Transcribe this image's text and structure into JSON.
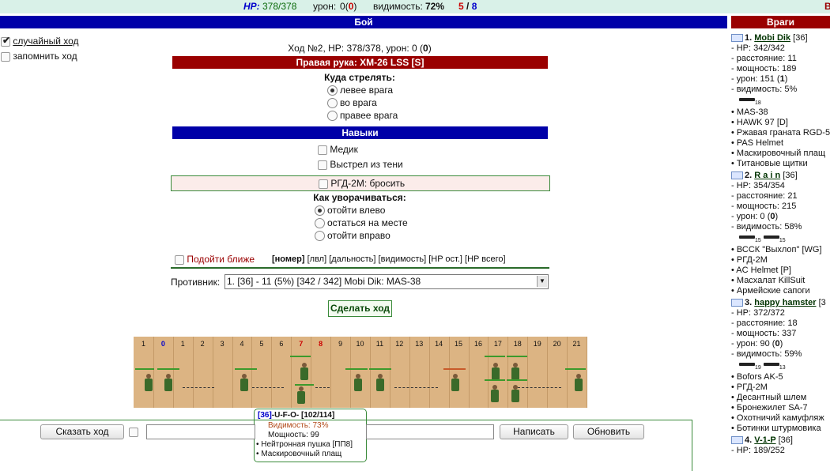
{
  "topbar": {
    "hp_label": "HP:",
    "hp_value": "378/378",
    "damage_label": "урон:",
    "damage_value": "0",
    "damage_paren_open": "(",
    "damage_bonus": "0",
    "damage_paren_close": ")",
    "visibility_label": "видимость:",
    "visibility_value": "72%",
    "team_red": "5",
    "team_sep": "/",
    "team_blue": "8",
    "right_cut": "В"
  },
  "battle_title": "Бой",
  "enemies_title": "Враги",
  "left_options": {
    "random_move": "случайный ход",
    "remember_move": "запомнить ход"
  },
  "turn_info": {
    "prefix": "Ход №2, HP: 378/378, урон: 0 (",
    "bold": "0",
    "suffix": ")"
  },
  "weapon_bar": "Правая рука: XM-26 LSS [S]",
  "shoot": {
    "title": "Куда стрелять:",
    "options": [
      "левее врага",
      "во врага",
      "правее врага"
    ]
  },
  "skills": {
    "title": "Навыки",
    "items": [
      "Медик",
      "Выстрел из тени"
    ]
  },
  "grenade": "РГД-2М: бросить",
  "dodge": {
    "title": "Как уворачиваться:",
    "options": [
      "отойти влево",
      "остаться на месте",
      "отойти вправо"
    ]
  },
  "approach": "Подойти ближе",
  "sort": {
    "number": "[номер]",
    "level": "[лвл]",
    "distance": "[дальность]",
    "visibility": "[видимость]",
    "hp_left": "[HP ост.]",
    "hp_total": "[HP всего]"
  },
  "opponent": {
    "label": "Противник:",
    "selected": "1. [36] - 11 (5%) [342 / 342] Mobi Dik: MAS-38"
  },
  "make_move": "Сделать ход",
  "field": {
    "columns": [
      "1",
      "0",
      "1",
      "2",
      "3",
      "4",
      "5",
      "6",
      "7",
      "8",
      "9",
      "10",
      "11",
      "12",
      "13",
      "14",
      "15",
      "16",
      "17",
      "18",
      "19",
      "20",
      "21"
    ]
  },
  "tooltip": {
    "level": "[36]",
    "name": "-U-F-O-",
    "hp": "[102/114]",
    "visibility": "Видимость: 73%",
    "power": "Мощность: 99",
    "items": [
      "Нейтронная пушка [ПП8]",
      "Маскировочный плащ"
    ]
  },
  "bottom": {
    "say_move": "Сказать ход",
    "write": "Написать",
    "refresh": "Обновить"
  },
  "enemies": [
    {
      "num": "1.",
      "name": "Mobi Dik",
      "level": "[36]",
      "hp": "- HP: 342/342",
      "distance": "- расстояние: 11",
      "power": "- мощность: 189",
      "damage_prefix": "- урон: 151 (",
      "damage_bold": "1",
      "damage_suffix": ")",
      "visibility": "- видимость: 5%",
      "gun_counts": [
        "18"
      ],
      "items": [
        "• MAS-38",
        "• HAWK 97 [D]",
        "• Ржавая граната RGD-5",
        "• PAS Helmet",
        "• Маскировочный плащ",
        "• Титановые щитки"
      ]
    },
    {
      "num": "2.",
      "name": "R a i n",
      "level": "[36]",
      "hp": "- HP: 354/354",
      "distance": "- расстояние: 21",
      "power": "- мощность: 215",
      "damage_prefix": "- урон: 0 (",
      "damage_bold": "0",
      "damage_suffix": ")",
      "visibility": "- видимость: 58%",
      "gun_counts": [
        "15",
        "15"
      ],
      "items": [
        "• ВССК \"Выхлоп\" [WG]",
        "• РГД-2М",
        "• AC Helmet [P]",
        "• Масхалат KillSuit",
        "• Армейские сапоги"
      ]
    },
    {
      "num": "3.",
      "name": "happy hamster",
      "level": "[3",
      "hp": "- HP: 372/372",
      "distance": "- расстояние: 18",
      "power": "- мощность: 337",
      "damage_prefix": "- урон: 90 (",
      "damage_bold": "0",
      "damage_suffix": ")",
      "visibility": "- видимость: 59%",
      "gun_counts": [
        "19",
        "13"
      ],
      "items": [
        "• Bofors AK-5",
        "• РГД-2М",
        "• Десантный шлем",
        "• Бронежилет SA-7",
        "• Охотничий камуфляж",
        "• Ботинки штурмовика"
      ]
    },
    {
      "num": "4.",
      "name": "V-1-P",
      "level": "[36]",
      "hp": "- HP: 189/252"
    }
  ],
  "colors": {
    "blue_bar": "#0000a8",
    "red_bar": "#9a0000",
    "topbar_bg": "#d9f1e8",
    "field_bg": "#dcb483"
  }
}
